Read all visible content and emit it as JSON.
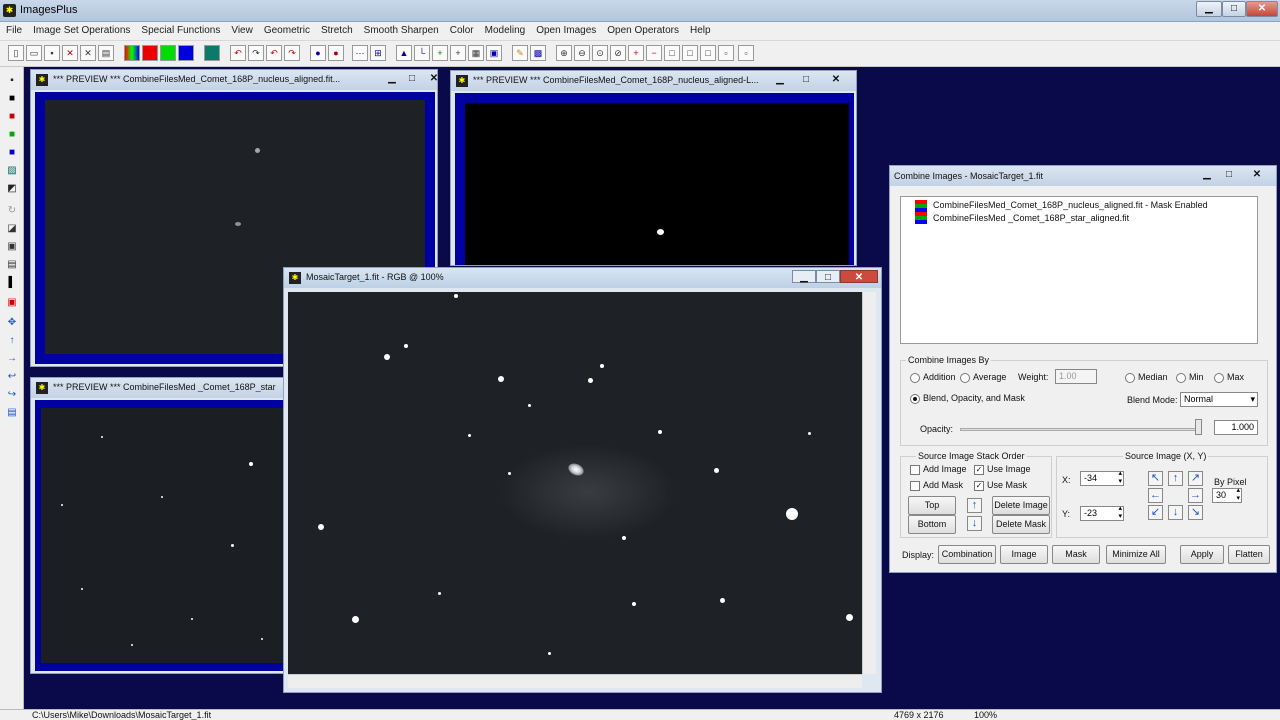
{
  "app": {
    "title": "ImagesPlus",
    "min": "▁",
    "max": "□",
    "close": "✕"
  },
  "menu": [
    "File",
    "Image Set Operations",
    "Special Functions",
    "View",
    "Geometric",
    "Stretch",
    "Smooth Sharpen",
    "Color",
    "Modeling",
    "Open Images",
    "Open Operators",
    "Help"
  ],
  "windows": {
    "preview1": {
      "title": "*** PREVIEW *** CombineFilesMed_Comet_168P_nucleus_aligned.fit..."
    },
    "preview2": {
      "title": "*** PREVIEW *** CombineFilesMed_Comet_168P_nucleus_aligned-L..."
    },
    "preview3": {
      "title": "*** PREVIEW *** CombineFilesMed _Comet_168P_star"
    },
    "mosaic": {
      "title": "MosaicTarget_1.fit - RGB @ 100%"
    }
  },
  "combine": {
    "title": "Combine Images - MosaicTarget_1.fit",
    "files": [
      "CombineFilesMed_Comet_168P_nucleus_aligned.fit - Mask Enabled",
      "CombineFilesMed _Comet_168P_star_aligned.fit"
    ],
    "by_label": "Combine Images By",
    "addition": "Addition",
    "average": "Average",
    "weight_label": "Weight:",
    "weight_value": "1.00",
    "median": "Median",
    "min": "Min",
    "max": "Max",
    "blend": "Blend, Opacity, and Mask",
    "blend_mode_label": "Blend Mode:",
    "blend_mode_value": "Normal",
    "opacity_label": "Opacity:",
    "opacity_value": "1.000",
    "stack_label": "Source Image Stack Order",
    "add_image": "Add Image",
    "use_image": "Use Image",
    "add_mask": "Add Mask",
    "use_mask": "Use Mask",
    "top": "Top",
    "bottom": "Bottom",
    "delete_image": "Delete Image",
    "delete_mask": "Delete Mask",
    "source_xy_label": "Source Image (X, Y)",
    "x_label": "X:",
    "x_value": "-34",
    "y_label": "Y:",
    "y_value": "-23",
    "by_pixel_label": "By Pixel",
    "by_pixel_value": "30",
    "display_label": "Display:",
    "combination": "Combination",
    "image": "Image",
    "mask": "Mask",
    "minimize_all": "Minimize All",
    "apply": "Apply",
    "flatten": "Flatten"
  },
  "status": {
    "path": "C:\\Users\\Mike\\Downloads\\MosaicTarget_1.fit",
    "size": "4769 x 2176",
    "zoom": "100%"
  },
  "colors": {
    "workspace": "#0a0a4a",
    "frame": "#0000a0",
    "sky": "#1e2226"
  }
}
